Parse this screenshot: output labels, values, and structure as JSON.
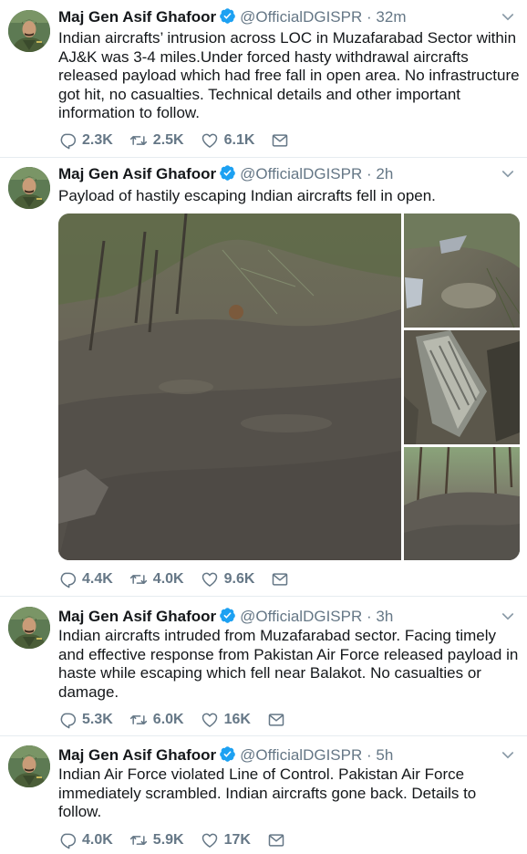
{
  "colors": {
    "link": "#1da1f2",
    "muted": "#657786",
    "text": "#14171a",
    "verified": "#1da1f2"
  },
  "icons": {
    "verified": "verified-badge-icon",
    "reply": "reply-icon",
    "retweet": "retweet-icon",
    "like": "heart-icon",
    "dm": "envelope-icon",
    "menu": "chevron-down-icon"
  },
  "tweets": [
    {
      "name": "Maj Gen Asif Ghafoor",
      "handle": "@OfficialDGISPR",
      "dot": "·",
      "time": "32m",
      "text": "Indian aircrafts’ intrusion across LOC in Muzafarabad Sector within AJ&K was 3-4 miles.Under forced hasty withdrawal aircrafts released payload which had free fall in open area. No infrastructure got hit, no casualties. Technical details and other important information to follow.",
      "replies": "2.3K",
      "retweets": "2.5K",
      "likes": "6.1K"
    },
    {
      "name": "Maj Gen Asif Ghafoor",
      "handle": "@OfficialDGISPR",
      "dot": "·",
      "time": "2h",
      "text": "Payload of hastily escaping Indian aircrafts fell in open.",
      "replies": "4.4K",
      "retweets": "4.0K",
      "likes": "9.6K"
    },
    {
      "name": "Maj Gen Asif Ghafoor",
      "handle": "@OfficialDGISPR",
      "dot": "·",
      "time": "3h",
      "text": "Indian aircrafts intruded from Muzafarabad sector. Facing timely and effective response from Pakistan Air Force released payload in haste while escaping which fell near Balakot. No casualties or damage.",
      "replies": "5.3K",
      "retweets": "6.0K",
      "likes": "16K"
    },
    {
      "name": "Maj Gen Asif Ghafoor",
      "handle": "@OfficialDGISPR",
      "dot": "·",
      "time": "5h",
      "text": "Indian Air Force violated Line of Control. Pakistan Air Force immediately scrambled. Indian aircrafts gone back. Details to follow.",
      "replies": "4.0K",
      "retweets": "5.9K",
      "likes": "17K"
    }
  ]
}
